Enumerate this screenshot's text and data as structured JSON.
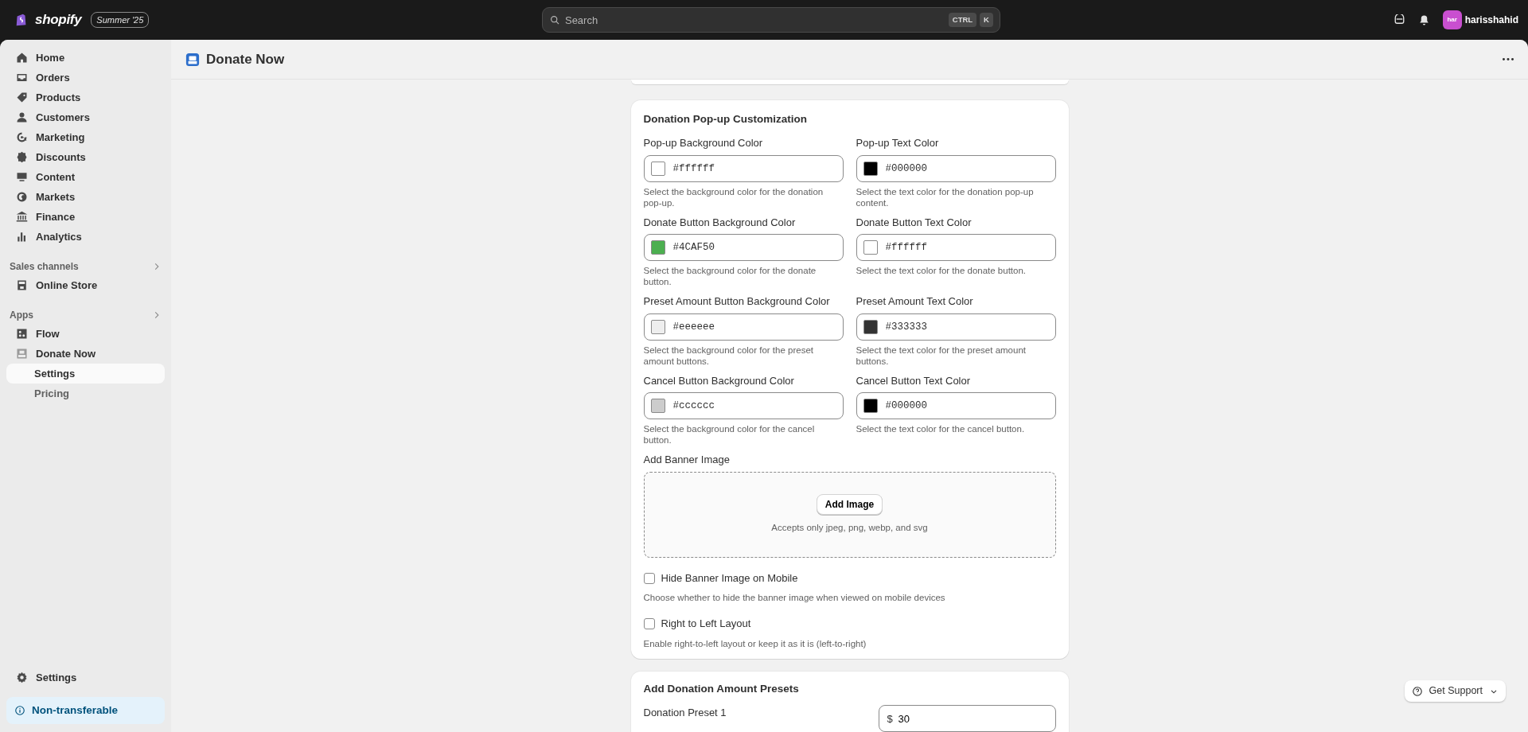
{
  "topbar": {
    "logo": "shopify",
    "edition_badge": "Summer '25",
    "search": {
      "placeholder": "Search",
      "keys": [
        "CTRL",
        "K"
      ]
    },
    "user": {
      "initials": "har",
      "name": "harisshahid"
    }
  },
  "sidebar": {
    "items": [
      {
        "label": "Home",
        "selected": false
      },
      {
        "label": "Orders",
        "selected": false
      },
      {
        "label": "Products",
        "selected": false
      },
      {
        "label": "Customers",
        "selected": false
      },
      {
        "label": "Marketing",
        "selected": false
      },
      {
        "label": "Discounts",
        "selected": false
      },
      {
        "label": "Content",
        "selected": false
      },
      {
        "label": "Markets",
        "selected": false
      },
      {
        "label": "Finance",
        "selected": false
      },
      {
        "label": "Analytics",
        "selected": false
      }
    ],
    "sales_channels": {
      "title": "Sales channels",
      "items": [
        {
          "label": "Online Store",
          "selected": false
        }
      ]
    },
    "apps": {
      "title": "Apps",
      "items": [
        {
          "label": "Flow",
          "selected": false
        },
        {
          "label": "Donate Now",
          "selected": false,
          "children": [
            {
              "label": "Settings",
              "selected": true
            },
            {
              "label": "Pricing",
              "selected": false
            }
          ]
        }
      ]
    },
    "settings": {
      "label": "Settings",
      "selected": false
    },
    "notice": "Non-transferable"
  },
  "page": {
    "title": "Donate Now"
  },
  "popup_card": {
    "title": "Donation Pop-up Customization",
    "color_fields": [
      {
        "label": "Pop-up Background Color",
        "value": "#ffffff",
        "color": "#ffffff",
        "help": "Select the background color for the donation pop-up."
      },
      {
        "label": "Pop-up Text Color",
        "value": "#000000",
        "color": "#000000",
        "help": "Select the text color for the donation pop-up content."
      },
      {
        "label": "Donate Button Background Color",
        "value": "#4CAF50",
        "color": "#4caf50",
        "help": "Select the background color for the donate button."
      },
      {
        "label": "Donate Button Text Color",
        "value": "#ffffff",
        "color": "#ffffff",
        "help": "Select the text color for the donate button."
      },
      {
        "label": "Preset Amount Button Background Color",
        "value": "#eeeeee",
        "color": "#eeeeee",
        "help": "Select the background color for the preset amount buttons."
      },
      {
        "label": "Preset Amount Text Color",
        "value": "#333333",
        "color": "#333333",
        "help": "Select the text color for the preset amount buttons."
      },
      {
        "label": "Cancel Button Background Color",
        "value": "#cccccc",
        "color": "#cccccc",
        "help": "Select the background color for the cancel button."
      },
      {
        "label": "Cancel Button Text Color",
        "value": "#000000",
        "color": "#000000",
        "help": "Select the text color for the cancel button."
      }
    ],
    "banner": {
      "label": "Add Banner Image",
      "button": "Add Image",
      "hint": "Accepts only jpeg, png, webp, and svg"
    },
    "options": [
      {
        "label": "Hide Banner Image on Mobile",
        "checked": false,
        "help": "Choose whether to hide the banner image when viewed on mobile devices"
      },
      {
        "label": "Right to Left Layout",
        "checked": false,
        "help": "Enable right-to-left layout or keep it as it is (left-to-right)"
      }
    ]
  },
  "presets_card": {
    "title": "Add Donation Amount Presets",
    "presets": [
      {
        "label": "Donation Preset 1",
        "prefix": "$",
        "value": "30"
      }
    ]
  },
  "support_button": "Get Support"
}
